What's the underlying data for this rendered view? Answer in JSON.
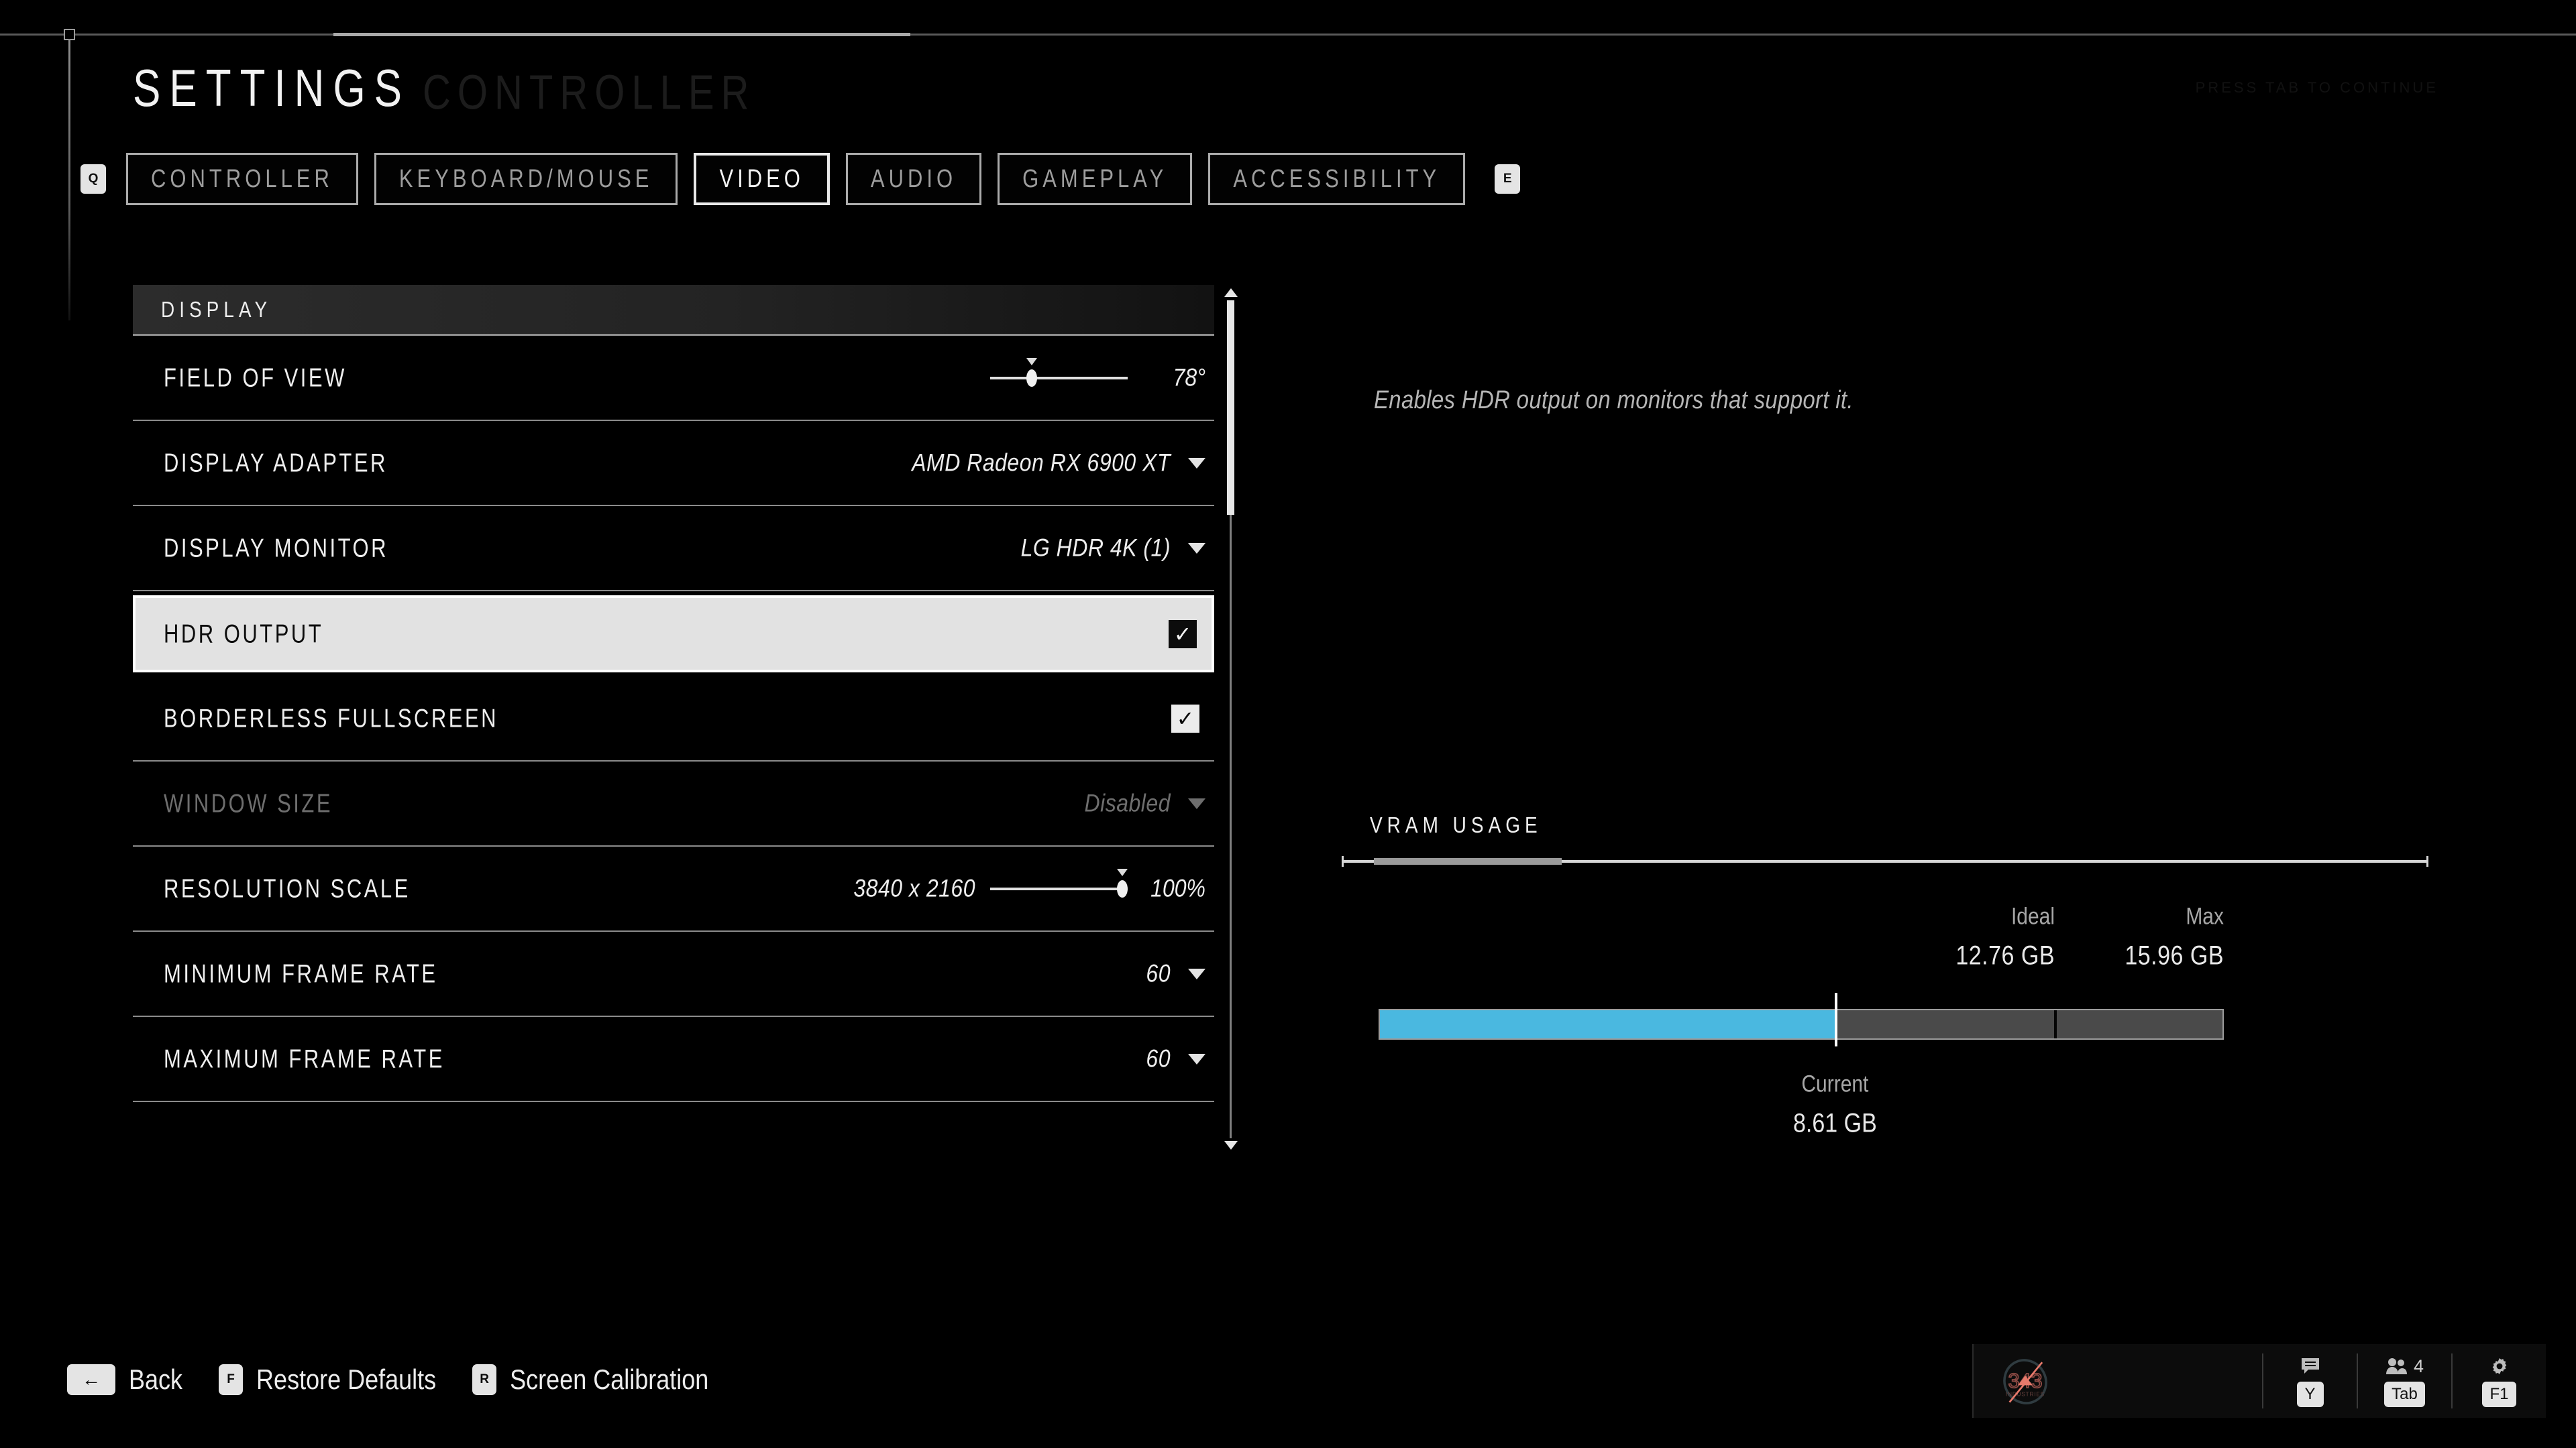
{
  "header": {
    "title": "SETTINGS",
    "title_ghost": "CONTROLLER",
    "right_ghost": "PRESS TAB TO CONTINUE"
  },
  "tabs": {
    "left_key": "Q",
    "right_key": "E",
    "items": [
      {
        "label": "CONTROLLER",
        "selected": false
      },
      {
        "label": "KEYBOARD/MOUSE",
        "selected": false
      },
      {
        "label": "VIDEO",
        "selected": true
      },
      {
        "label": "AUDIO",
        "selected": false
      },
      {
        "label": "GAMEPLAY",
        "selected": false
      },
      {
        "label": "ACCESSIBILITY",
        "selected": false
      }
    ]
  },
  "settings": {
    "section_title": "DISPLAY",
    "rows": [
      {
        "label": "FIELD OF VIEW",
        "type": "slider",
        "value": "78°",
        "percent": 30
      },
      {
        "label": "DISPLAY ADAPTER",
        "type": "dropdown",
        "value": "AMD Radeon RX 6900 XT"
      },
      {
        "label": "DISPLAY MONITOR",
        "type": "dropdown",
        "value": "LG HDR 4K (1)"
      },
      {
        "label": "HDR OUTPUT",
        "type": "checkbox",
        "value": "✓",
        "focused": true
      },
      {
        "label": "BORDERLESS FULLSCREEN",
        "type": "checkbox",
        "value": "✓"
      },
      {
        "label": "WINDOW SIZE",
        "type": "dropdown",
        "value": "Disabled",
        "disabled": true
      },
      {
        "label": "RESOLUTION SCALE",
        "type": "slider",
        "value": "100%",
        "prefix": "3840 x 2160",
        "percent": 96
      },
      {
        "label": "MINIMUM FRAME RATE",
        "type": "dropdown",
        "value": "60"
      },
      {
        "label": "MAXIMUM FRAME RATE",
        "type": "dropdown",
        "value": "60"
      }
    ]
  },
  "description": "Enables HDR output on monitors that support it.",
  "vram": {
    "title": "VRAM USAGE",
    "ideal_label": "Ideal",
    "ideal_value": "12.76 GB",
    "max_label": "Max",
    "max_value": "15.96 GB",
    "current_label": "Current",
    "current_value": "8.61 GB",
    "fill_color": "#4ab8e0",
    "current_percent": 54,
    "ideal_percent": 80
  },
  "footer": {
    "hints": [
      {
        "key": "←",
        "label": "Back",
        "wide": true
      },
      {
        "key": "F",
        "label": "Restore Defaults",
        "wide": false
      },
      {
        "key": "R",
        "label": "Screen Calibration",
        "wide": false
      }
    ]
  },
  "hud": {
    "logo": "343 INDUSTRIES",
    "chat_key": "Y",
    "roster_key": "Tab",
    "roster_count": "4",
    "settings_key": "F1"
  }
}
